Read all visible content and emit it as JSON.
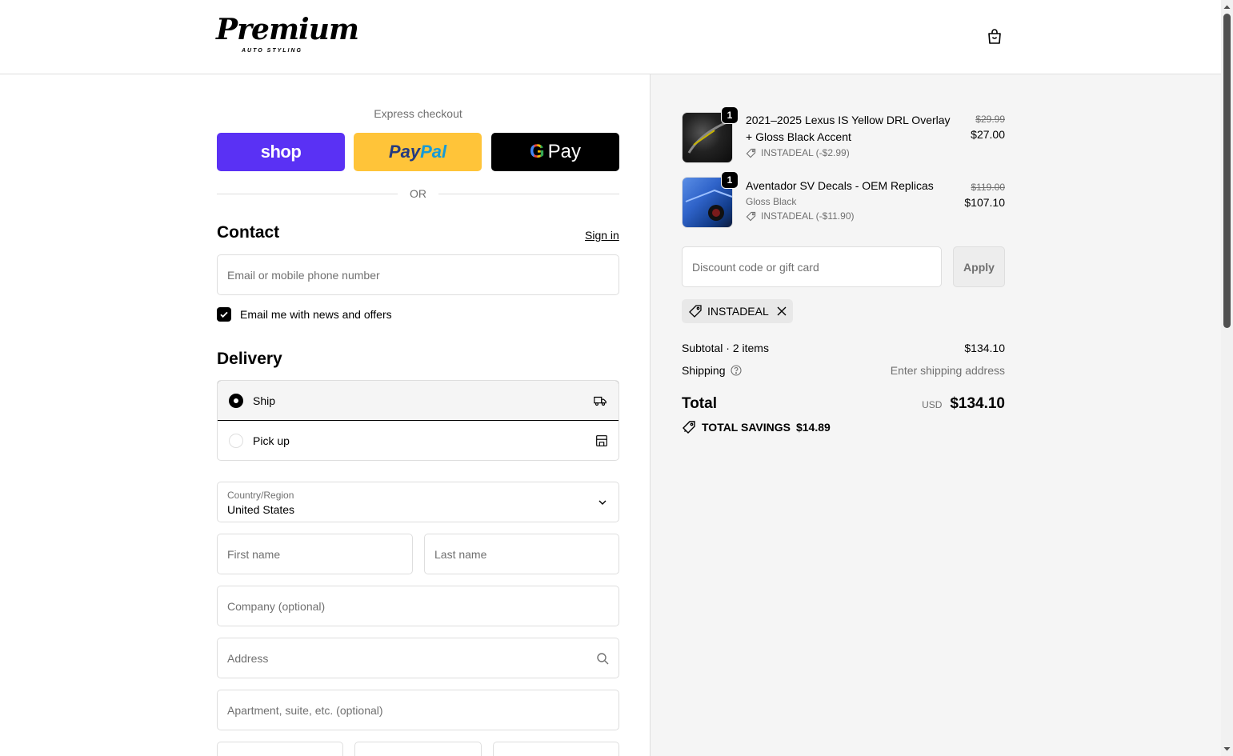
{
  "header": {
    "logo_text": "Premium",
    "logo_sub": "AUTO STYLING",
    "cart_icon": "shopping-bag-icon"
  },
  "express": {
    "label": "Express checkout",
    "shop_label": "shop",
    "paypal_label_1": "Pay",
    "paypal_label_2": "Pal",
    "gpay_g": "G",
    "gpay_label": "Pay",
    "or_label": "OR"
  },
  "contact": {
    "title": "Contact",
    "signin_label": "Sign in",
    "email_placeholder": "Email or mobile phone number",
    "newsletter_label": "Email me with news and offers",
    "newsletter_checked": true
  },
  "delivery": {
    "title": "Delivery",
    "options": [
      {
        "label": "Ship",
        "selected": true,
        "icon": "truck-icon"
      },
      {
        "label": "Pick up",
        "selected": false,
        "icon": "store-icon"
      }
    ],
    "country_label": "Country/Region",
    "country_value": "United States",
    "first_name_placeholder": "First name",
    "last_name_placeholder": "Last name",
    "company_placeholder": "Company (optional)",
    "address_placeholder": "Address",
    "apartment_placeholder": "Apartment, suite, etc. (optional)"
  },
  "cart": {
    "items": [
      {
        "name": "2021–2025 Lexus IS Yellow DRL Overlay + Gloss Black Accent",
        "variant": "",
        "quantity": "1",
        "discount": "INSTADEAL (-$2.99)",
        "price_original": "$29.99",
        "price": "$27.00"
      },
      {
        "name": "Aventador SV Decals - OEM Replicas",
        "variant": "Gloss Black",
        "quantity": "1",
        "discount": "INSTADEAL (-$11.90)",
        "price_original": "$119.00",
        "price": "$107.10"
      }
    ],
    "discount_placeholder": "Discount code or gift card",
    "apply_label": "Apply",
    "applied_code": "INSTADEAL",
    "subtotal_label": "Subtotal · 2 items",
    "subtotal_value": "$134.10",
    "shipping_label": "Shipping",
    "shipping_value": "Enter shipping address",
    "total_label": "Total",
    "total_currency": "USD",
    "total_value": "$134.10",
    "savings_label": "TOTAL SAVINGS",
    "savings_value": "$14.89"
  },
  "colors": {
    "shop_purple": "#5a31f4",
    "paypal_yellow": "#ffc439",
    "panel_bg": "#f5f5f5"
  }
}
